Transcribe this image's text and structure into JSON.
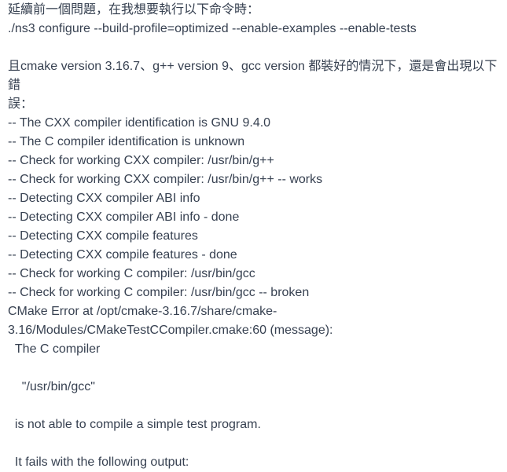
{
  "message": {
    "intro": "延續前一個問題，在我想要執行以下命令時：",
    "command": "./ns3 configure --build-profile=optimized --enable-examples --enable-tests",
    "context_line_1": "且cmake version 3.16.7、g++ version 9、gcc version 都裝好的情況下，還是會出現以下錯",
    "context_line_2": "誤：",
    "log": [
      "-- The CXX compiler identification is GNU 9.4.0",
      "-- The C compiler identification is unknown",
      "-- Check for working CXX compiler: /usr/bin/g++",
      "-- Check for working CXX compiler: /usr/bin/g++ -- works",
      "-- Detecting CXX compiler ABI info",
      "-- Detecting CXX compiler ABI info - done",
      "-- Detecting CXX compile features",
      "-- Detecting CXX compile features - done",
      "-- Check for working C compiler: /usr/bin/gcc",
      "-- Check for working C compiler: /usr/bin/gcc -- broken",
      "CMake Error at /opt/cmake-3.16.7/share/cmake-",
      "3.16/Modules/CMakeTestCCompiler.cmake:60 (message):"
    ],
    "error_body": {
      "line_1": "  The C compiler",
      "line_2": "    \"/usr/bin/gcc\"",
      "line_3": "  is not able to compile a simple test program.",
      "line_4": "  It fails with the following output:"
    }
  }
}
